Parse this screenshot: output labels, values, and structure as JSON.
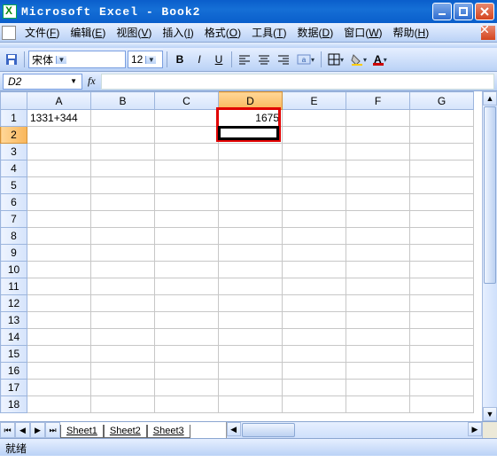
{
  "titlebar": {
    "title": "Microsoft Excel - Book2"
  },
  "menu": {
    "file": {
      "label": "文件",
      "key": "F"
    },
    "edit": {
      "label": "编辑",
      "key": "E"
    },
    "view": {
      "label": "视图",
      "key": "V"
    },
    "insert": {
      "label": "插入",
      "key": "I"
    },
    "format": {
      "label": "格式",
      "key": "O"
    },
    "tools": {
      "label": "工具",
      "key": "T"
    },
    "data": {
      "label": "数据",
      "key": "D"
    },
    "window": {
      "label": "窗口",
      "key": "W"
    },
    "help": {
      "label": "帮助",
      "key": "H"
    }
  },
  "toolbar": {
    "font_name": "宋体",
    "font_size": "12",
    "bold": "B",
    "italic": "I",
    "underline": "U"
  },
  "formulabar": {
    "name_box": "D2",
    "fx_label": "fx",
    "formula": ""
  },
  "columns": [
    "A",
    "B",
    "C",
    "D",
    "E",
    "F",
    "G"
  ],
  "rows": [
    "1",
    "2",
    "3",
    "4",
    "5",
    "6",
    "7",
    "8",
    "9",
    "10",
    "11",
    "12",
    "13",
    "14",
    "15",
    "16",
    "17",
    "18"
  ],
  "selected_column": "D",
  "selected_row": "2",
  "cells": {
    "A1": "1331+344",
    "D1": "1675"
  },
  "highlight_range": "D1:D2",
  "active_cell": "D2",
  "sheets": {
    "s1": "Sheet1",
    "s2": "Sheet2",
    "s3": "Sheet3",
    "active": "Sheet1"
  },
  "status": {
    "ready": "就绪"
  }
}
